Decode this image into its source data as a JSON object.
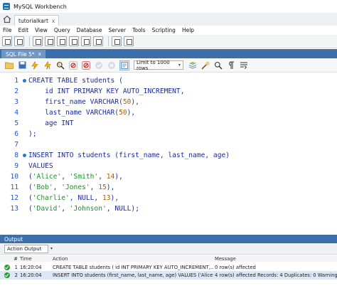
{
  "window": {
    "title": "MySQL Workbench"
  },
  "connection_tab": {
    "label": "tutorialkart",
    "close": "x"
  },
  "menu": [
    "File",
    "Edit",
    "View",
    "Query",
    "Database",
    "Server",
    "Tools",
    "Scripting",
    "Help"
  ],
  "editor_tab": {
    "label": "SQL File 5*",
    "close": "x"
  },
  "query_toolbar": {
    "limit": "Limit to 1000 rows",
    "limit_caret": "▾"
  },
  "editor": {
    "lines": [
      {
        "n": "1",
        "marker": true,
        "tokens": [
          {
            "t": "CREATE TABLE students (",
            "c": "kw"
          }
        ]
      },
      {
        "n": "2",
        "marker": false,
        "tokens": [
          {
            "t": "    id INT PRIMARY KEY AUTO_INCREMENT,",
            "c": "kw"
          }
        ]
      },
      {
        "n": "3",
        "marker": false,
        "tokens": [
          {
            "t": "    first_name VARCHAR(",
            "c": "kw"
          },
          {
            "t": "50",
            "c": "num"
          },
          {
            "t": "),",
            "c": "kw"
          }
        ]
      },
      {
        "n": "4",
        "marker": false,
        "tokens": [
          {
            "t": "    last_name VARCHAR(",
            "c": "kw"
          },
          {
            "t": "50",
            "c": "num"
          },
          {
            "t": "),",
            "c": "kw"
          }
        ]
      },
      {
        "n": "5",
        "marker": false,
        "tokens": [
          {
            "t": "    age INT",
            "c": "kw"
          }
        ]
      },
      {
        "n": "6",
        "marker": false,
        "tokens": [
          {
            "t": ");",
            "c": "kw"
          }
        ]
      },
      {
        "n": "7",
        "marker": false,
        "tokens": []
      },
      {
        "n": "8",
        "marker": true,
        "tokens": [
          {
            "t": "INSERT INTO students (first_name, last_name, age)",
            "c": "kw"
          }
        ]
      },
      {
        "n": "9",
        "marker": false,
        "tokens": [
          {
            "t": "VALUES",
            "c": "kw"
          }
        ]
      },
      {
        "n": "10",
        "marker": false,
        "tokens": [
          {
            "t": "(",
            "c": "kw"
          },
          {
            "t": "'Alice'",
            "c": "str"
          },
          {
            "t": ", ",
            "c": "kw"
          },
          {
            "t": "'Smith'",
            "c": "str"
          },
          {
            "t": ", ",
            "c": "kw"
          },
          {
            "t": "14",
            "c": "num"
          },
          {
            "t": "),",
            "c": "kw"
          }
        ]
      },
      {
        "n": "11",
        "marker": false,
        "tokens": [
          {
            "t": "(",
            "c": "kw"
          },
          {
            "t": "'Bob'",
            "c": "str"
          },
          {
            "t": ", ",
            "c": "kw"
          },
          {
            "t": "'Jones'",
            "c": "str"
          },
          {
            "t": ", ",
            "c": "kw"
          },
          {
            "t": "15",
            "c": "num"
          },
          {
            "t": "),",
            "c": "kw"
          }
        ]
      },
      {
        "n": "12",
        "marker": false,
        "tokens": [
          {
            "t": "(",
            "c": "kw"
          },
          {
            "t": "'Charlie'",
            "c": "str"
          },
          {
            "t": ", NULL, ",
            "c": "kw"
          },
          {
            "t": "13",
            "c": "num"
          },
          {
            "t": "),",
            "c": "kw"
          }
        ]
      },
      {
        "n": "13",
        "marker": false,
        "tokens": [
          {
            "t": "(",
            "c": "kw"
          },
          {
            "t": "'David'",
            "c": "str"
          },
          {
            "t": ", ",
            "c": "kw"
          },
          {
            "t": "'Johnson'",
            "c": "str"
          },
          {
            "t": ", NULL);",
            "c": "kw"
          }
        ]
      }
    ]
  },
  "output": {
    "title": "Output",
    "selector": "Action Output",
    "caret": "▾",
    "columns": {
      "num": "#",
      "time": "Time",
      "action": "Action",
      "message": "Message"
    },
    "rows": [
      {
        "num": "1",
        "time": "16:20:04",
        "action": "CREATE TABLE students (    id INT PRIMARY KEY AUTO_INCREMENT,...",
        "message": "0 row(s) affected"
      },
      {
        "num": "2",
        "time": "16:20:04",
        "action": "INSERT INTO students (first_name, last_name, age) VALUES  ('Alice', 'Smi...",
        "message": "4 row(s) affected Records: 4  Duplicates: 0  Warnings: 0"
      }
    ]
  },
  "colors": {
    "panel_blue": "#3c6fa9",
    "keyword": "#1b2a9c",
    "string": "#1d8f26",
    "number": "#b55a00",
    "line_number": "#1d57d8",
    "ok_green": "#2e9b3a"
  }
}
